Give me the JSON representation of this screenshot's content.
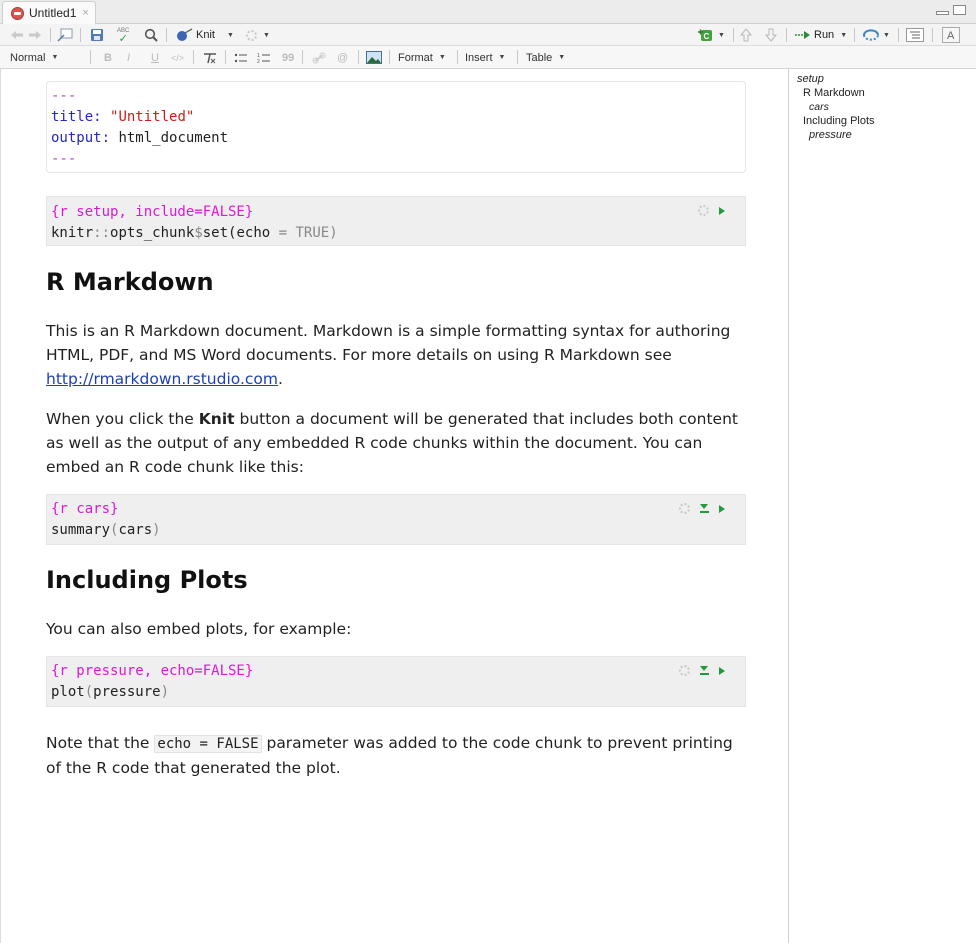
{
  "tab": {
    "title": "Untitled1",
    "close": "×"
  },
  "toolbar": {
    "knit_label": "Knit",
    "run_label": "Run",
    "spell": "ABC"
  },
  "format_bar": {
    "style": "Normal",
    "bold": "B",
    "italic": "I",
    "underline": "U",
    "code": "</>",
    "quote": "99",
    "format": "Format",
    "insert": "Insert",
    "table": "Table"
  },
  "yaml": {
    "dashes": "---",
    "title_key": "title:",
    "title_val": "\"Untitled\"",
    "output_key": "output:",
    "output_val": "html_document"
  },
  "chunk_setup": {
    "header": "{r setup, include=FALSE}",
    "line1": "knitr",
    "line2": "::",
    "line3": "opts_chunk",
    "line4": "$",
    "line5": "set(echo",
    "line6": " = ",
    "line7": "TRUE",
    "line8": ")"
  },
  "h_rmarkdown": "R Markdown",
  "para1": {
    "text": "This is an R Markdown document. Markdown is a simple formatting syntax for authoring HTML, PDF, and MS Word documents. For more details on using R Markdown see ",
    "link": "http://rmarkdown.rstudio.com",
    "end": "."
  },
  "para2": {
    "pre": "When you click the ",
    "bold": "Knit",
    "post": " button a document will be generated that includes both content as well as the output of any embedded R code chunks within the document. You can embed an R code chunk like this:"
  },
  "chunk_cars": {
    "header": "{r cars}",
    "fn": "summary",
    "open": "(",
    "arg": "cars",
    "close": ")"
  },
  "h_plots": "Including Plots",
  "para3": "You can also embed plots, for example:",
  "chunk_pressure": {
    "header": "{r pressure, echo=FALSE}",
    "fn": "plot",
    "open": "(",
    "arg": "pressure",
    "close": ")"
  },
  "para4": {
    "pre": "Note that the ",
    "code": "echo = FALSE",
    "post": " parameter was added to the code chunk to prevent printing of the R code that generated the plot."
  },
  "outline": {
    "items": [
      "setup",
      "R Markdown",
      "cars",
      "Including Plots",
      "pressure"
    ]
  }
}
